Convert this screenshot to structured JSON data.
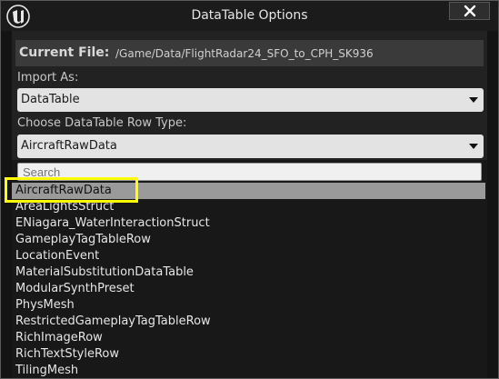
{
  "window": {
    "title": "DataTable Options"
  },
  "current_file": {
    "label": "Current File:",
    "value": "/Game/Data/FlightRadar24_SFO_to_CPH_SK936"
  },
  "import_as": {
    "label": "Import As:",
    "selected": "DataTable"
  },
  "row_type": {
    "label": "Choose DataTable Row Type:",
    "selected": "AircraftRawData"
  },
  "search": {
    "placeholder": "Search"
  },
  "row_types": [
    "AircraftRawData",
    "AreaLightsStruct",
    "ENiagara_WaterInteractionStruct",
    "GameplayTagTableRow",
    "LocationEvent",
    "MaterialSubstitutionDataTable",
    "ModularSynthPreset",
    "PhysMesh",
    "RestrictedGameplayTagTableRow",
    "RichImageRow",
    "RichTextStyleRow",
    "TilingMesh"
  ],
  "colors": {
    "highlight": "#ffff00",
    "selected_row": "#9a9a9a"
  }
}
